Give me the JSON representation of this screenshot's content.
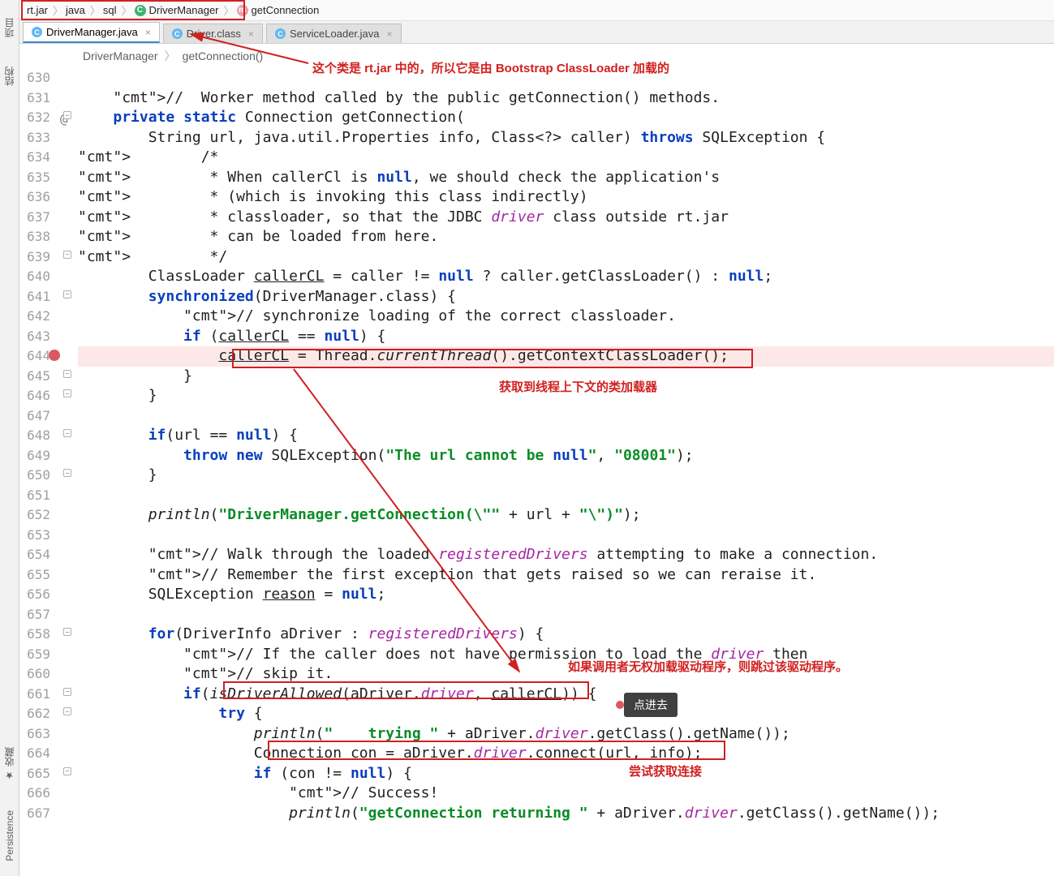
{
  "left_toolbar": {
    "project": "项目",
    "structure": "结构",
    "favorites": "收藏",
    "persistence": "Persistence"
  },
  "breadcrumb": {
    "i0": "rt.jar",
    "i1": "java",
    "i2": "sql",
    "i3": "DriverManager",
    "i4": "getConnection"
  },
  "tabs": {
    "t0": "DriverManager.java",
    "t1": "Driver.class",
    "t2": "ServiceLoader.java"
  },
  "sub_bc": {
    "a": "DriverManager",
    "b": "getConnection()"
  },
  "annot": {
    "top": "这个类是 rt.jar 中的，所以它是由 Bootstrap ClassLoader 加载的",
    "mid": "获取到线程上下文的类加载器",
    "right": "如果调用者无权加载驱动程序，则跳过该驱动程序。",
    "tip": "点进去",
    "bottom": "尝试获取连接"
  },
  "lines": {
    "start": 630,
    "code": [
      "",
      "    //  Worker method called by the public getConnection() methods.",
      "    private static Connection getConnection(",
      "        String url, java.util.Properties info, Class<?> caller) throws SQLException {",
      "        /*",
      "         * When callerCl is null, we should check the application's",
      "         * (which is invoking this class indirectly)",
      "         * classloader, so that the JDBC driver class outside rt.jar",
      "         * can be loaded from here.",
      "         */",
      "        ClassLoader callerCL = caller != null ? caller.getClassLoader() : null;",
      "        synchronized(DriverManager.class) {",
      "            // synchronize loading of the correct classloader.",
      "            if (callerCL == null) {",
      "                callerCL = Thread.currentThread().getContextClassLoader();",
      "            }",
      "        }",
      "",
      "        if(url == null) {",
      "            throw new SQLException(\"The url cannot be null\", \"08001\");",
      "        }",
      "",
      "        println(\"DriverManager.getConnection(\\\"\" + url + \"\\\")\");",
      "",
      "        // Walk through the loaded registeredDrivers attempting to make a connection.",
      "        // Remember the first exception that gets raised so we can reraise it.",
      "        SQLException reason = null;",
      "",
      "        for(DriverInfo aDriver : registeredDrivers) {",
      "            // If the caller does not have permission to load the driver then",
      "            // skip it.",
      "            if(isDriverAllowed(aDriver.driver, callerCL)) {",
      "                try {",
      "                    println(\"    trying \" + aDriver.driver.getClass().getName());",
      "                    Connection con = aDriver.driver.connect(url, info);",
      "                    if (con != null) {",
      "                        // Success!",
      "                        println(\"getConnection returning \" + aDriver.driver.getClass().getName());"
    ]
  }
}
